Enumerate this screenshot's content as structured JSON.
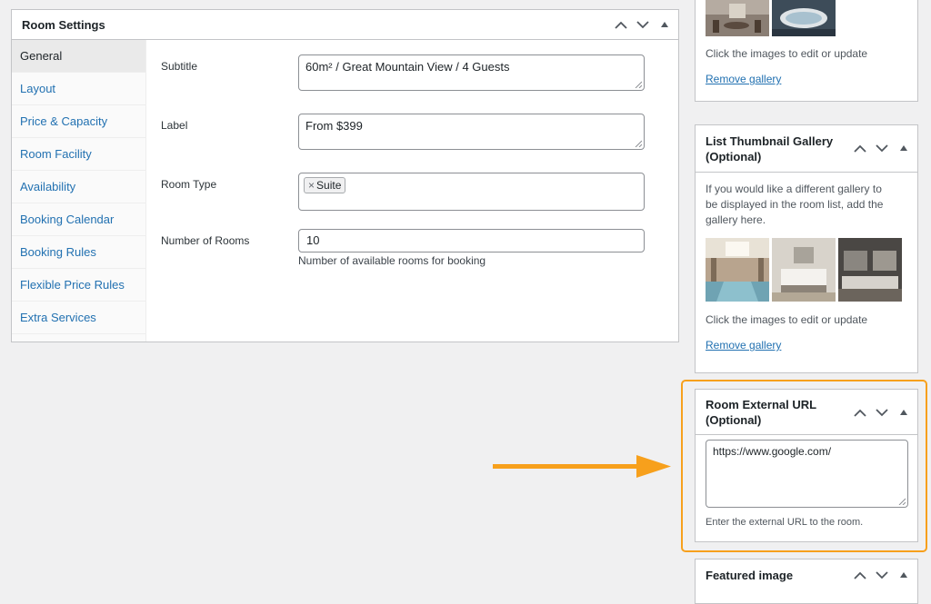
{
  "room_settings": {
    "title": "Room Settings",
    "tabs": [
      {
        "label": "General"
      },
      {
        "label": "Layout"
      },
      {
        "label": "Price & Capacity"
      },
      {
        "label": "Room Facility"
      },
      {
        "label": "Availability"
      },
      {
        "label": "Booking Calendar"
      },
      {
        "label": "Booking Rules"
      },
      {
        "label": "Flexible Price Rules"
      },
      {
        "label": "Extra Services"
      }
    ],
    "fields": {
      "subtitle_label": "Subtitle",
      "subtitle_value": "60m² / Great Mountain View / 4 Guests",
      "label_label": "Label",
      "label_value": "From $399",
      "room_type_label": "Room Type",
      "room_type_tag": "Suite",
      "room_type_tag_remove": "×",
      "rooms_label": "Number of Rooms",
      "rooms_value": "10",
      "rooms_help": "Number of available rooms for booking"
    }
  },
  "gallery": {
    "hint": "Click the images to edit or update",
    "remove": "Remove gallery"
  },
  "list_thumbnail_gallery": {
    "title_line1": "List Thumbnail Gallery",
    "title_line2": "(Optional)",
    "description": "If you would like a different gallery to be displayed in the room list, add the gallery here.",
    "hint": "Click the images to edit or update",
    "remove": "Remove gallery",
    "images": [
      "pool-photo",
      "bedroom-photo",
      "living-room-photo"
    ]
  },
  "external_url": {
    "title_line1": "Room External URL",
    "title_line2": "(Optional)",
    "value": "https://www.google.com/",
    "help": "Enter the external URL to the room."
  },
  "featured_image": {
    "title": "Featured image"
  },
  "colors": {
    "highlight": "#f7a01c",
    "link": "#2271b1"
  }
}
